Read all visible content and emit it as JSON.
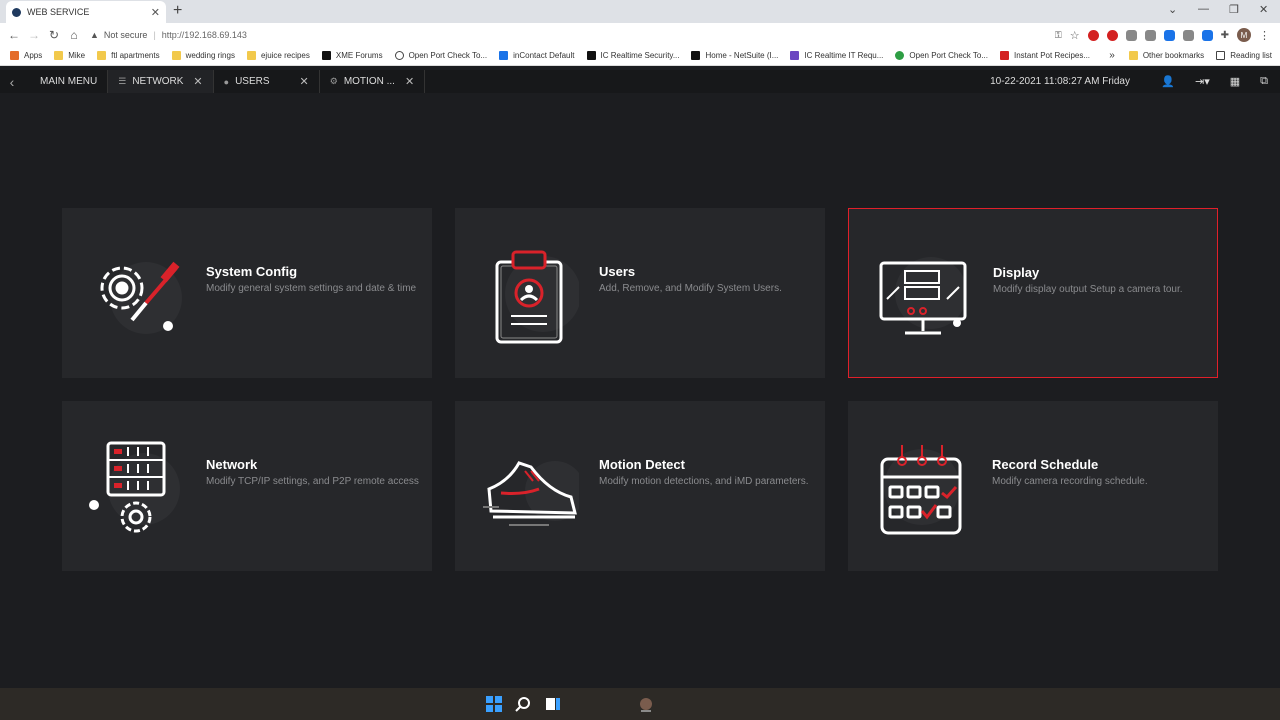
{
  "browser": {
    "tab_title": "WEB SERVICE",
    "security_label": "Not secure",
    "url": "http://192.168.69.143",
    "avatar_letter": "M"
  },
  "bookmarks": [
    {
      "label": "Apps",
      "icon": "apps-grid-icon"
    },
    {
      "label": "Mike",
      "icon": "folder-icon"
    },
    {
      "label": "ftl apartments",
      "icon": "folder-icon"
    },
    {
      "label": "wedding rings",
      "icon": "folder-icon"
    },
    {
      "label": "ejuice recipes",
      "icon": "folder-icon"
    },
    {
      "label": "XME Forums",
      "icon": "site-icon"
    },
    {
      "label": "Open Port Check To...",
      "icon": "globe-icon"
    },
    {
      "label": "inContact Default",
      "icon": "site-icon"
    },
    {
      "label": "IC Realtime Security...",
      "icon": "site-icon"
    },
    {
      "label": "Home - NetSuite (I...",
      "icon": "site-icon"
    },
    {
      "label": "IC Realtime IT Requ...",
      "icon": "site-icon"
    },
    {
      "label": "Open Port Check To...",
      "icon": "globe-icon"
    },
    {
      "label": "Instant Pot Recipes...",
      "icon": "site-icon"
    }
  ],
  "bookmarks_right": {
    "more": "»",
    "other": "Other bookmarks",
    "reading": "Reading list"
  },
  "appbar": {
    "tabs": [
      {
        "label": "MAIN MENU",
        "closable": false
      },
      {
        "label": "NETWORK",
        "closable": true
      },
      {
        "label": "USERS",
        "closable": true
      },
      {
        "label": "MOTION ...",
        "closable": true
      }
    ],
    "datetime": "10-22-2021 11:08:27 AM Friday"
  },
  "cards": [
    {
      "title": "System Config",
      "desc": "Modify general system settings and date & time"
    },
    {
      "title": "Users",
      "desc": "Add, Remove, and Modify System Users."
    },
    {
      "title": "Display",
      "desc": "Modify display output Setup a camera tour."
    },
    {
      "title": "Network",
      "desc": "Modify TCP/IP settings, and P2P remote access"
    },
    {
      "title": "Motion Detect",
      "desc": "Modify motion detections, and iMD parameters."
    },
    {
      "title": "Record Schedule",
      "desc": "Modify camera recording schedule."
    }
  ],
  "colors": {
    "accent": "#e0202a",
    "background": "#1c1d20",
    "card": "#26272a"
  }
}
